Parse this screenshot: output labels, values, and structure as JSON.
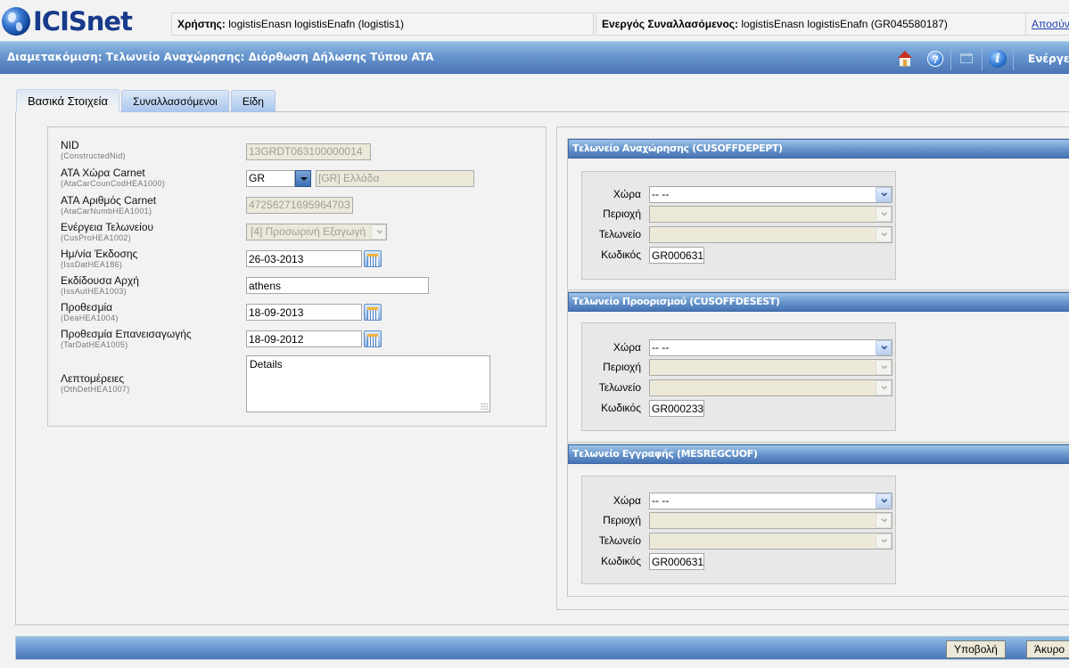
{
  "app": {
    "logo_text": "ICISnet",
    "user_label": "Χρήστης:",
    "user_value": "logistisEnasn logistisEnafn (logistis1)",
    "trader_label": "Ενεργός Συναλλασόμενος:",
    "trader_value": "logistisEnasn logistisEnafn (GR045580187)",
    "logout_link": "Αποσύνδεση"
  },
  "title_bar": {
    "title": "Διαμετακόμιση: Τελωνείο Αναχώρησης: Διόρθωση Δήλωσης Τύπου ATA",
    "icons": [
      "home-icon",
      "help-icon",
      "window-icon",
      "info-icon"
    ],
    "action_label": "Ενέργειες"
  },
  "tabs": [
    {
      "label": "Βασικά Στοιχεία",
      "active": true
    },
    {
      "label": "Συναλλασσόμενοι",
      "active": false
    },
    {
      "label": "Είδη",
      "active": false
    }
  ],
  "basic_form": {
    "nid": {
      "label": "NID",
      "code": "(ConstructedNid)",
      "value": "13GRDT063100000014"
    },
    "ata_country": {
      "label": "ATA Χώρα Carnet",
      "code": "(AtaCarCounCodHEA1000)",
      "value": "GR",
      "description": "[GR] Ελλάδα"
    },
    "ata_number": {
      "label": "ATA Αριθμός Carnet",
      "code": "(AtaCarNumbHEA1001)",
      "value": "4725627169596470З"
    },
    "customs_action": {
      "label": "Ενέργεια Τελωνείου",
      "code": "(CusProHEA1002)",
      "value": "[4] Προσωρινή Εξαγωγή"
    },
    "issue_date": {
      "label": "Ημ/νία Έκδοσης",
      "code": "(IssDatHEA186)",
      "value": "26-03-2013"
    },
    "issuing_authority": {
      "label": "Εκδίδουσα Αρχή",
      "code": "(IssAutHEA1003)",
      "value": "athens"
    },
    "deadline": {
      "label": "Προθεσμία",
      "code": "(DeaHEA1004)",
      "value": "18-09-2013"
    },
    "reimport_deadline": {
      "label": "Προθεσμία Επανεισαγωγής",
      "code": "(TarDatHEA1005)",
      "value": "18-09-2012"
    },
    "details": {
      "label": "Λεπτομέρειες",
      "code": "(OthDetHEA1007)",
      "value": "Details"
    }
  },
  "offices": [
    {
      "title": "Τελωνείο Αναχώρησης (CUSOFFDEPEPT)",
      "country_label": "Χώρα",
      "country_value": "-- --",
      "region_label": "Περιοχή",
      "region_value": "",
      "office_label": "Τελωνείο",
      "office_value": "",
      "code_label": "Κωδικός",
      "code_value": "GR000631"
    },
    {
      "title": "Τελωνείο Προορισμού (CUSOFFDESEST)",
      "country_label": "Χώρα",
      "country_value": "-- --",
      "region_label": "Περιοχή",
      "region_value": "",
      "office_label": "Τελωνείο",
      "office_value": "",
      "code_label": "Κωδικός",
      "code_value": "GR000233"
    },
    {
      "title": "Τελωνείο Εγγραφής (MESREGCUOF)",
      "country_label": "Χώρα",
      "country_value": "-- --",
      "region_label": "Περιοχή",
      "region_value": "",
      "office_label": "Τελωνείο",
      "office_value": "",
      "code_label": "Κωδικός",
      "code_value": "GR000631"
    }
  ],
  "footer": {
    "submit_label": "Υποβολή",
    "cancel_label": "Άκυρο"
  },
  "colors": {
    "header_blue": "#4a76b6",
    "header_light": "#93bde4",
    "disabled_field": "#ece9d8",
    "logo_blue": "#173a8a"
  }
}
